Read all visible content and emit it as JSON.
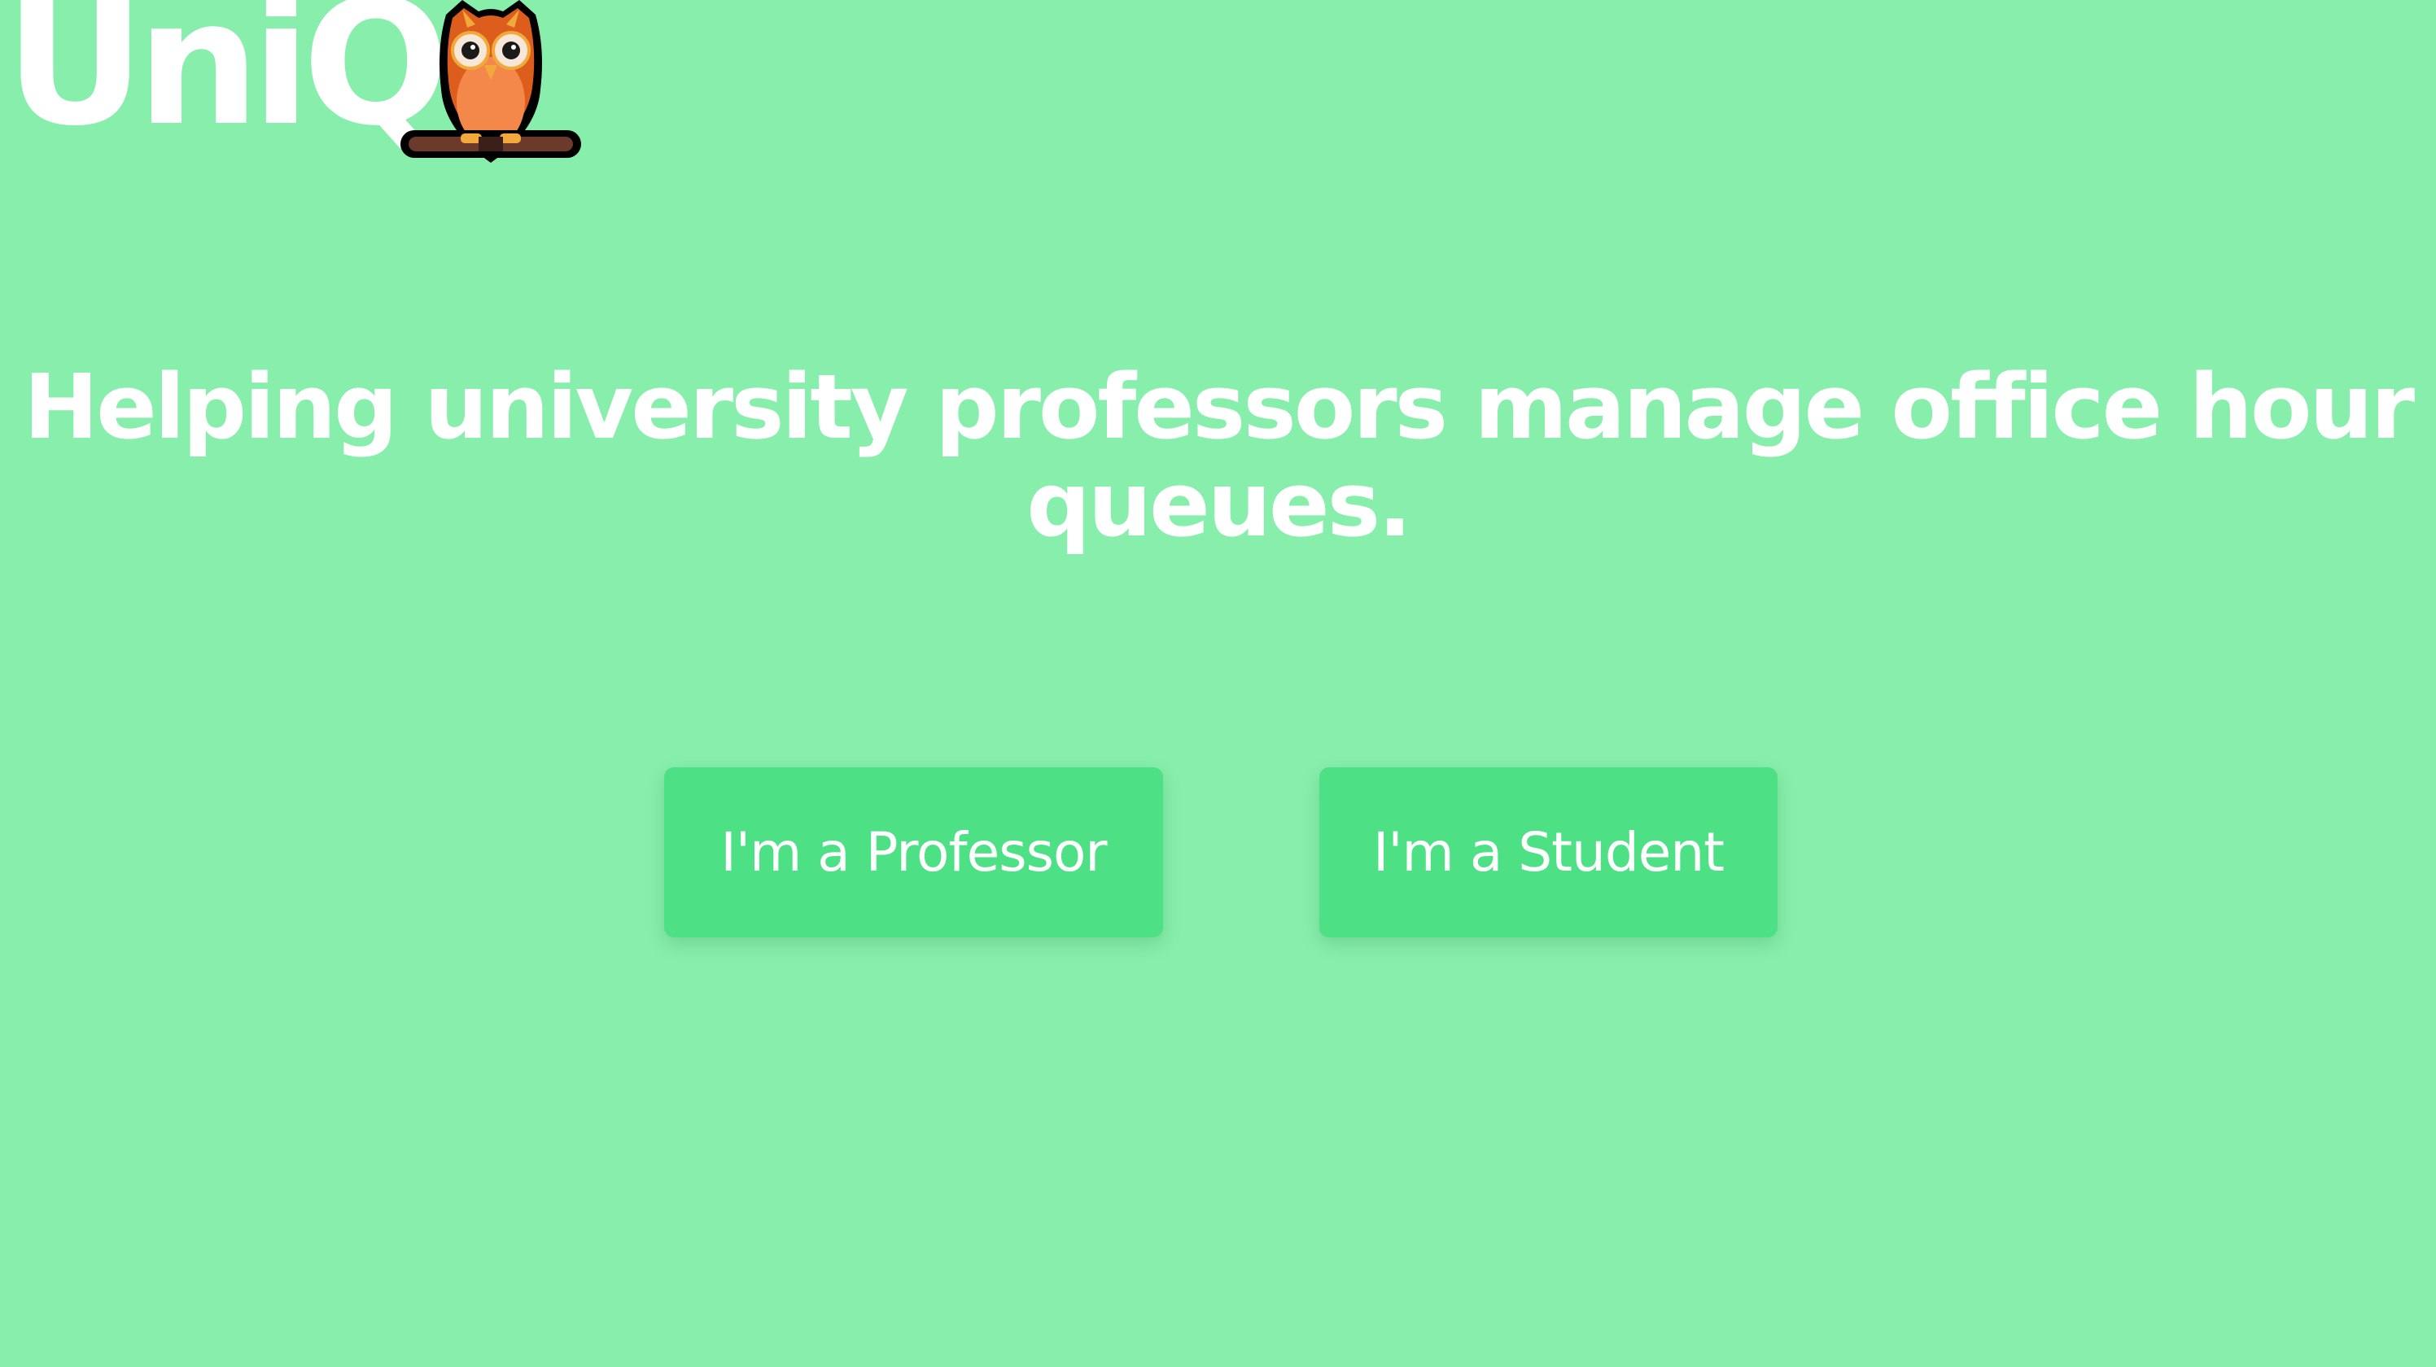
{
  "header": {
    "brand": "UniQ",
    "logo_icon": "owl-icon"
  },
  "hero": {
    "tagline": "Helping university professors manage office hour queues."
  },
  "actions": {
    "professor_label": "I'm a Professor",
    "student_label": "I'm a Student"
  },
  "colors": {
    "background": "#87efab",
    "button": "#4ee084",
    "text": "#ffffff"
  }
}
